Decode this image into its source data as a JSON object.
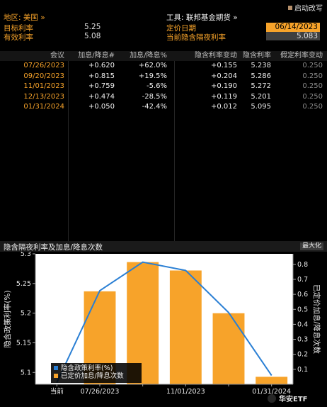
{
  "header": {
    "region_label": "地区: 美国 »",
    "instrument_label": "工具: 联邦基金期货 »",
    "action_button": "启动改写",
    "rows": [
      {
        "left_label": "目标利率",
        "left_value": "5.25",
        "right_label": "定价日期",
        "right_value": "06/14/2023"
      },
      {
        "left_label": "有效利率",
        "left_value": "5.08",
        "right_label": "当前隐含隔夜利率",
        "right_value": "5.083"
      }
    ]
  },
  "table": {
    "columns": [
      "会议",
      "加息/降息#",
      "加息/降息%",
      "隐含利率变动",
      "隐含利率",
      "假定利率变动"
    ],
    "rows": [
      [
        "07/26/2023",
        "+0.620",
        "+62.0%",
        "+0.155",
        "5.238",
        "0.250"
      ],
      [
        "09/20/2023",
        "+0.815",
        "+19.5%",
        "+0.204",
        "5.286",
        "0.250"
      ],
      [
        "11/01/2023",
        "+0.759",
        "-5.6%",
        "+0.190",
        "5.272",
        "0.250"
      ],
      [
        "12/13/2023",
        "+0.474",
        "-28.5%",
        "+0.119",
        "5.201",
        "0.250"
      ],
      [
        "01/31/2024",
        "+0.050",
        "-42.4%",
        "+0.012",
        "5.095",
        "0.250"
      ]
    ]
  },
  "chart_section": {
    "title": "隐含隔夜利率及加息/降息次数",
    "maximize_label": "最大化"
  },
  "watermark": {
    "text": "华安ETF"
  },
  "colors": {
    "accent_orange": "#f7a32a",
    "line_blue": "#2a7fd4",
    "background": "#000000"
  },
  "chart_data": {
    "type": "bar",
    "categories": [
      "当前",
      "07/26/2023",
      "09/20/2023",
      "11/01/2023",
      "12/13/2023",
      "01/31/2024"
    ],
    "x_tick_labels": [
      "当前",
      "07/26/2023",
      "11/01/2023",
      "01/31/2024"
    ],
    "series": [
      {
        "name": "隐含政策利率(%)",
        "type": "line",
        "axis": "left",
        "color": "#2a7fd4",
        "values": [
          5.083,
          5.238,
          5.286,
          5.272,
          5.201,
          5.095
        ]
      },
      {
        "name": "已定价加息/降息次数",
        "type": "bar",
        "axis": "right",
        "color": "#f7a32a",
        "values": [
          null,
          0.62,
          0.815,
          0.759,
          0.474,
          0.05
        ]
      }
    ],
    "ylabel": "隐含政策利率(%)",
    "y2label": "已定价加息/降息次数",
    "ylim": [
      5.08,
      5.3
    ],
    "y_ticks": [
      5.1,
      5.15,
      5.2,
      5.25,
      5.3
    ],
    "y2lim": [
      0,
      0.87
    ],
    "y2_ticks": [
      0.1,
      0.2,
      0.3,
      0.4,
      0.5,
      0.6,
      0.7,
      0.8
    ],
    "legend_position": "bottom-left",
    "legend_entries": [
      "隐含政策利率(%)",
      "已定价加息/降息次数"
    ],
    "grid": false
  }
}
